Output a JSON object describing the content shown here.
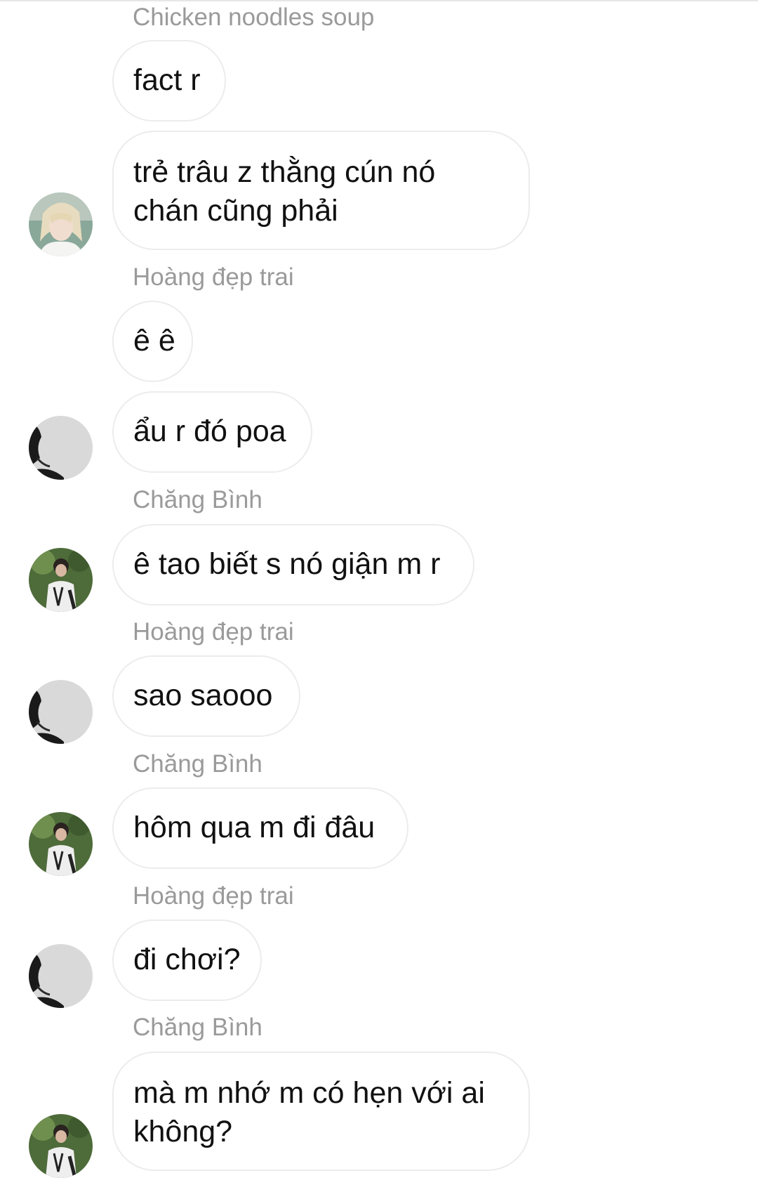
{
  "conversation": {
    "messages": [
      {
        "sender": "Chicken noodles soup",
        "text": "fact r"
      },
      {
        "text": "trẻ trâu z thằng cún nó chán cũng phải",
        "avatar": "blonde-profile-avatar"
      },
      {
        "sender": "Hoàng đẹp trai",
        "text": "ê ê"
      },
      {
        "text": "ẩu r đó poa",
        "avatar": "grey-silhouette-avatar"
      },
      {
        "sender": "Chăng Bình",
        "text": "ê tao biết s nó giận m r",
        "avatar": "outdoor-photo-avatar"
      },
      {
        "sender": "Hoàng đẹp trai",
        "text": "sao saooo",
        "avatar": "grey-silhouette-avatar"
      },
      {
        "sender": "Chăng Bình",
        "text": "hôm qua m đi đâu",
        "avatar": "outdoor-photo-avatar"
      },
      {
        "sender": "Hoàng đẹp trai",
        "text": "đi chơi?",
        "avatar": "grey-silhouette-avatar"
      },
      {
        "sender": "Chăng Bình",
        "text": "mà m nhớ m có hẹn với ai không?",
        "avatar": "outdoor-photo-avatar"
      }
    ]
  },
  "colors": {
    "bubble_border": "#ececec",
    "sender_name": "#9a9a9a",
    "message_text": "#111111",
    "background": "#ffffff"
  }
}
